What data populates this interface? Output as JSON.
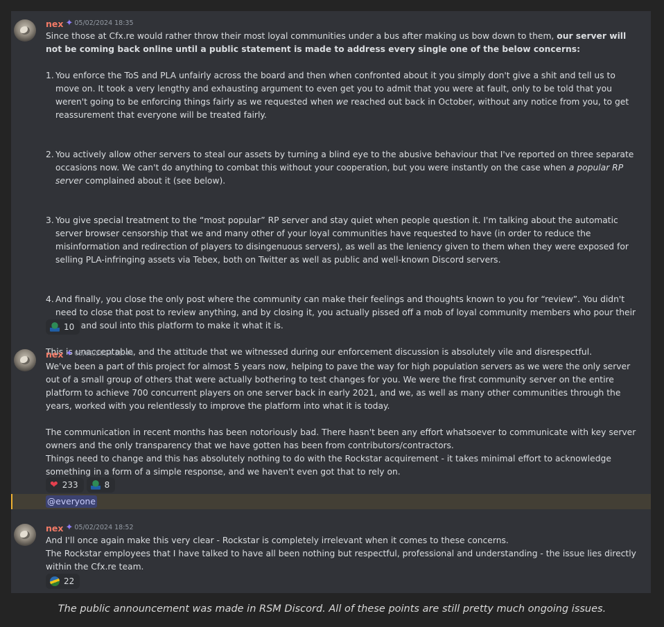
{
  "messages": [
    {
      "username": "nex",
      "timestamp": "05/02/2024 18:35",
      "intro_text": "Since those at Cfx.re would rather throw their most loyal communities under a bus after making us bow down to them, ",
      "intro_bold": "our server will not be coming back online until a public statement is made to address every single one of the below concerns:",
      "points": [
        {
          "num": "1.",
          "text_a": "You enforce the ToS and PLA unfairly across the board and then when confronted about it you simply don't give a shit and tell us to move on. It took a very lengthy and exhausting argument to even get you to admit that you were at fault, only to be told that you weren't going to be enforcing things fairly as we requested when ",
          "text_em": "we",
          "text_b": " reached out back in October, without any notice from you, to get reassurement that everyone will be treated fairly."
        },
        {
          "num": "2.",
          "text_a": "You actively allow other servers to steal our assets by turning a blind eye to the abusive behaviour that I've reported on three separate occasions now. We can't do anything to combat this without your cooperation, but you were instantly on the case when ",
          "text_em": "a popular RP server",
          "text_b": " complained about it (see below)."
        },
        {
          "num": "3.",
          "text_a": "You give special treatment to the “most popular” RP server and stay quiet when people question it. I'm talking about the automatic server browser censorship that we and many other of your loyal communities have requested to have (in order to reduce the misinformation and redirection of players to disingenuous servers), as well as the leniency given to them when they were exposed for selling PLA-infringing assets via Tebex, both on Twitter as well as public and well-known Discord servers.",
          "text_em": "",
          "text_b": ""
        },
        {
          "num": "4.",
          "text_a": "And finally, you close the only post where the community can make their feelings and thoughts known to you for “review”. You didn't need to close that post to review anything, and by closing it, you actually pissed off a mob of loyal community members who pour their heart and soul into this platform to make it what it is.",
          "text_em": "",
          "text_b": ""
        }
      ],
      "closing": "This is unacceptable, and the attitude that we witnessed during our enforcement discussion is absolutely vile and disrespectful.",
      "reactions": [
        {
          "icon": "green-frog-emoji-icon",
          "count": "10"
        }
      ]
    },
    {
      "username": "nex",
      "timestamp": "05/02/2024 18:44",
      "para1": "We've been a part of this project for almost 5 years now, helping to pave the way for high population servers as we were the only server out of a small group of others that were actually bothering to test changes for you. We were the first community server on the entire platform to achieve 700 concurrent players on one server back in early 2021, and we, as well as many other communities through the years, worked with you relentlessly to improve the platform into what it is today.",
      "para2": "The communication in recent months has been notoriously bad. There hasn't been any effort whatsoever to communicate with key server owners and the only transparency that we have gotten has been from contributors/contractors.",
      "para3": "Things need to change and this has absolutely nothing to do with the Rockstar acquirement - it takes minimal effort to acknowledge something in a form of a simple response, and we haven't even got that to rely on.",
      "reactions": [
        {
          "icon": "heart-icon",
          "count": "233"
        },
        {
          "icon": "green-frog-emoji-icon",
          "count": "8"
        }
      ],
      "mention": "@everyone"
    },
    {
      "username": "nex",
      "timestamp": "05/02/2024 18:52",
      "line1": "And I'll once again make this very clear - Rockstar is completely irrelevant when it comes to these concerns.",
      "line2": "The Rockstar employees that I have talked to have all been nothing but respectful, professional and understanding - the issue lies directly within the Cfx.re team.",
      "reactions": [
        {
          "icon": "shrug-emoji-icon",
          "count": "22"
        }
      ]
    }
  ],
  "badge_icon": "sparkle-badge-icon",
  "caption": "The public announcement was made in RSM Discord. All of these points are still pretty much ongoing issues."
}
